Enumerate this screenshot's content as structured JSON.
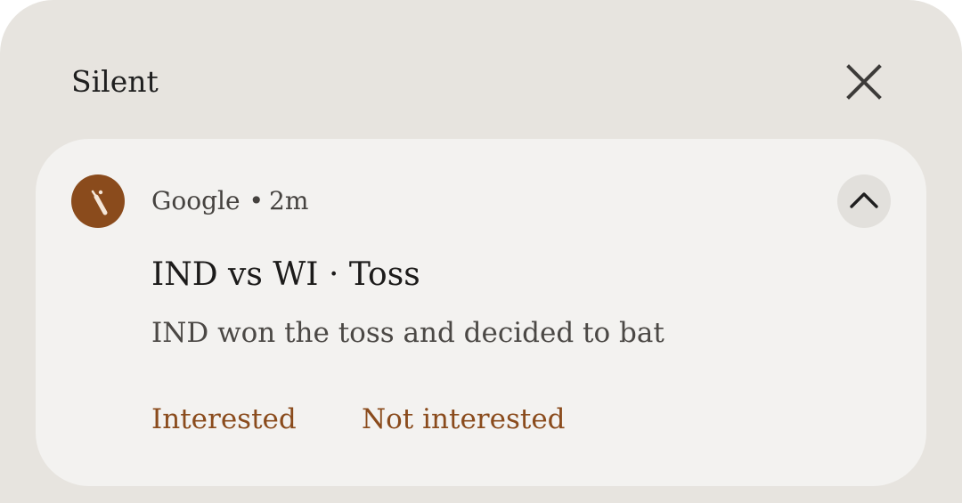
{
  "shade": {
    "section_title": "Silent",
    "dismiss_icon": "close-icon"
  },
  "notification": {
    "app_icon": "cricket-bat-icon",
    "app_name": "Google",
    "separator": "•",
    "time": "2m",
    "expand_icon": "chevron-up-icon",
    "title": "IND vs WI · Toss",
    "body": "IND won the toss and decided to bat",
    "actions": [
      {
        "label": "Interested"
      },
      {
        "label": "Not interested"
      }
    ]
  },
  "colors": {
    "background": "#e7e4df",
    "card": "#f3f2f0",
    "accent": "#8a4b1c",
    "expand_button": "#e2e0dc"
  }
}
